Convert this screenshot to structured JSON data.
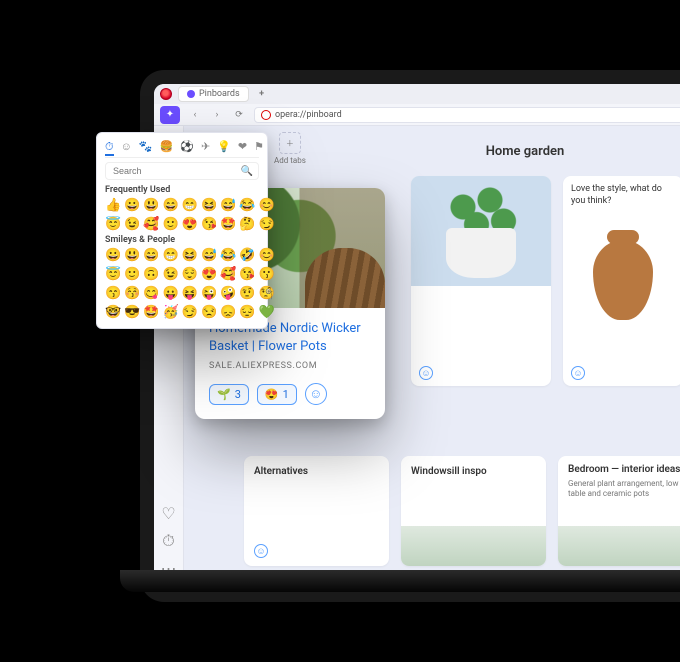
{
  "browser": {
    "tab_label": "Pinboards",
    "address": "opera://pinboard",
    "newtab_glyph": "+"
  },
  "sidebar": {
    "addtabs_label": "Add tabs"
  },
  "board": {
    "title": "Home garden"
  },
  "cards": {
    "c1": {
      "title": "Homemade Nordic Wicker Basket | Flower Pots",
      "source": "SALE.ALIEXPRESS.COM"
    },
    "c2": {
      "caption": "Love the style, what do you think?"
    },
    "c3": {
      "title": "Alternatives"
    },
    "c4": {
      "title": "Windowsill inspo"
    },
    "c5": {
      "title": "Bedroom — interior ideas",
      "sub": "General plant arrangement, low table and ceramic pots"
    }
  },
  "reactions": {
    "seed_count": "3",
    "heart_count": "1",
    "seed_emoji": "🌱",
    "heart_emoji": "😍",
    "add_glyph": "☺"
  },
  "picker": {
    "search_placeholder": "Search",
    "tabs": {
      "recent": "⏱",
      "smileys": "☺",
      "animals": "🐾",
      "food": "🍔",
      "activity": "⚽",
      "travel": "✈",
      "objects": "💡",
      "symbols": "❤",
      "flags": "⚑"
    },
    "section_frequent": "Frequently Used",
    "section_smileys": "Smileys & People",
    "frequent": [
      "👍",
      "😀",
      "😃",
      "😄",
      "😁",
      "😆",
      "😅",
      "😂",
      "😊",
      "😇",
      "😉",
      "🥰",
      "🙂",
      "😍",
      "😘",
      "🤩",
      "🤔",
      "😏"
    ],
    "smileys_rows": [
      [
        "😀",
        "😃",
        "😄",
        "😁",
        "😆",
        "😅",
        "😂",
        "🤣",
        "😊"
      ],
      [
        "😇",
        "🙂",
        "🙃",
        "😉",
        "😌",
        "😍",
        "🥰",
        "😘",
        "😗"
      ],
      [
        "😙",
        "😚",
        "😋",
        "😛",
        "😝",
        "😜",
        "🤪",
        "🤨",
        "🧐"
      ],
      [
        "🤓",
        "😎",
        "🤩",
        "🥳",
        "😏",
        "😒",
        "😞",
        "😔",
        "💚"
      ]
    ]
  }
}
